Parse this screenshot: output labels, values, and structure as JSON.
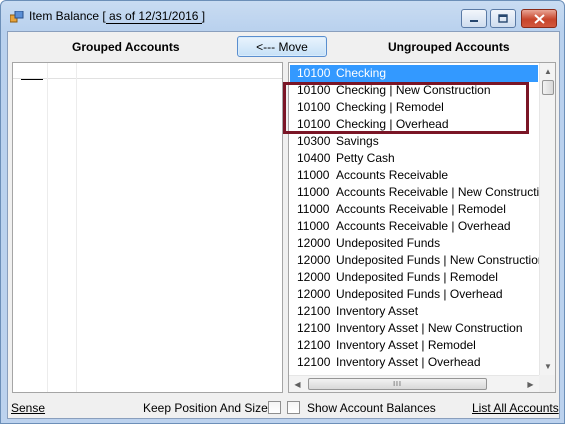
{
  "window": {
    "title_prefix": "Item Balance [",
    "title_date": " as of 12/31/2016 ",
    "title_suffix": "]",
    "minimize_glyph": "—",
    "maximize_glyph": "▭",
    "close_glyph": "✕"
  },
  "toolbar": {
    "grouped_header": "Grouped Accounts",
    "ungrouped_header": "Ungrouped Accounts",
    "move_label": "<--- Move"
  },
  "ungrouped_accounts": [
    {
      "num": "10100",
      "name": "Checking",
      "selected": true
    },
    {
      "num": "10100",
      "name": "Checking | New Construction"
    },
    {
      "num": "10100",
      "name": "Checking | Remodel"
    },
    {
      "num": "10100",
      "name": "Checking | Overhead"
    },
    {
      "num": "10300",
      "name": "Savings"
    },
    {
      "num": "10400",
      "name": "Petty Cash"
    },
    {
      "num": "11000",
      "name": "Accounts Receivable"
    },
    {
      "num": "11000",
      "name": "Accounts Receivable | New Construction"
    },
    {
      "num": "11000",
      "name": "Accounts Receivable | Remodel"
    },
    {
      "num": "11000",
      "name": "Accounts Receivable | Overhead"
    },
    {
      "num": "12000",
      "name": "Undeposited Funds"
    },
    {
      "num": "12000",
      "name": "Undeposited Funds | New Construction"
    },
    {
      "num": "12000",
      "name": "Undeposited Funds | Remodel"
    },
    {
      "num": "12000",
      "name": "Undeposited Funds | Overhead"
    },
    {
      "num": "12100",
      "name": "Inventory Asset"
    },
    {
      "num": "12100",
      "name": "Inventory Asset | New Construction"
    },
    {
      "num": "12100",
      "name": "Inventory Asset | Remodel"
    },
    {
      "num": "12100",
      "name": "Inventory Asset | Overhead"
    }
  ],
  "scrollbar": {
    "up_glyph": "▲",
    "down_glyph": "▼",
    "left_glyph": "◀",
    "right_glyph": "▶",
    "grip_glyph": "III"
  },
  "footer": {
    "sense_link": "Sense",
    "keep_position_label": "Keep Position And Size",
    "keep_position_checked": false,
    "show_balances_label": "Show Account Balances",
    "show_balances_checked": false,
    "list_all_link": "List All Accounts"
  },
  "colors": {
    "selection": "#3399ff",
    "highlight_box": "#7a1526"
  }
}
